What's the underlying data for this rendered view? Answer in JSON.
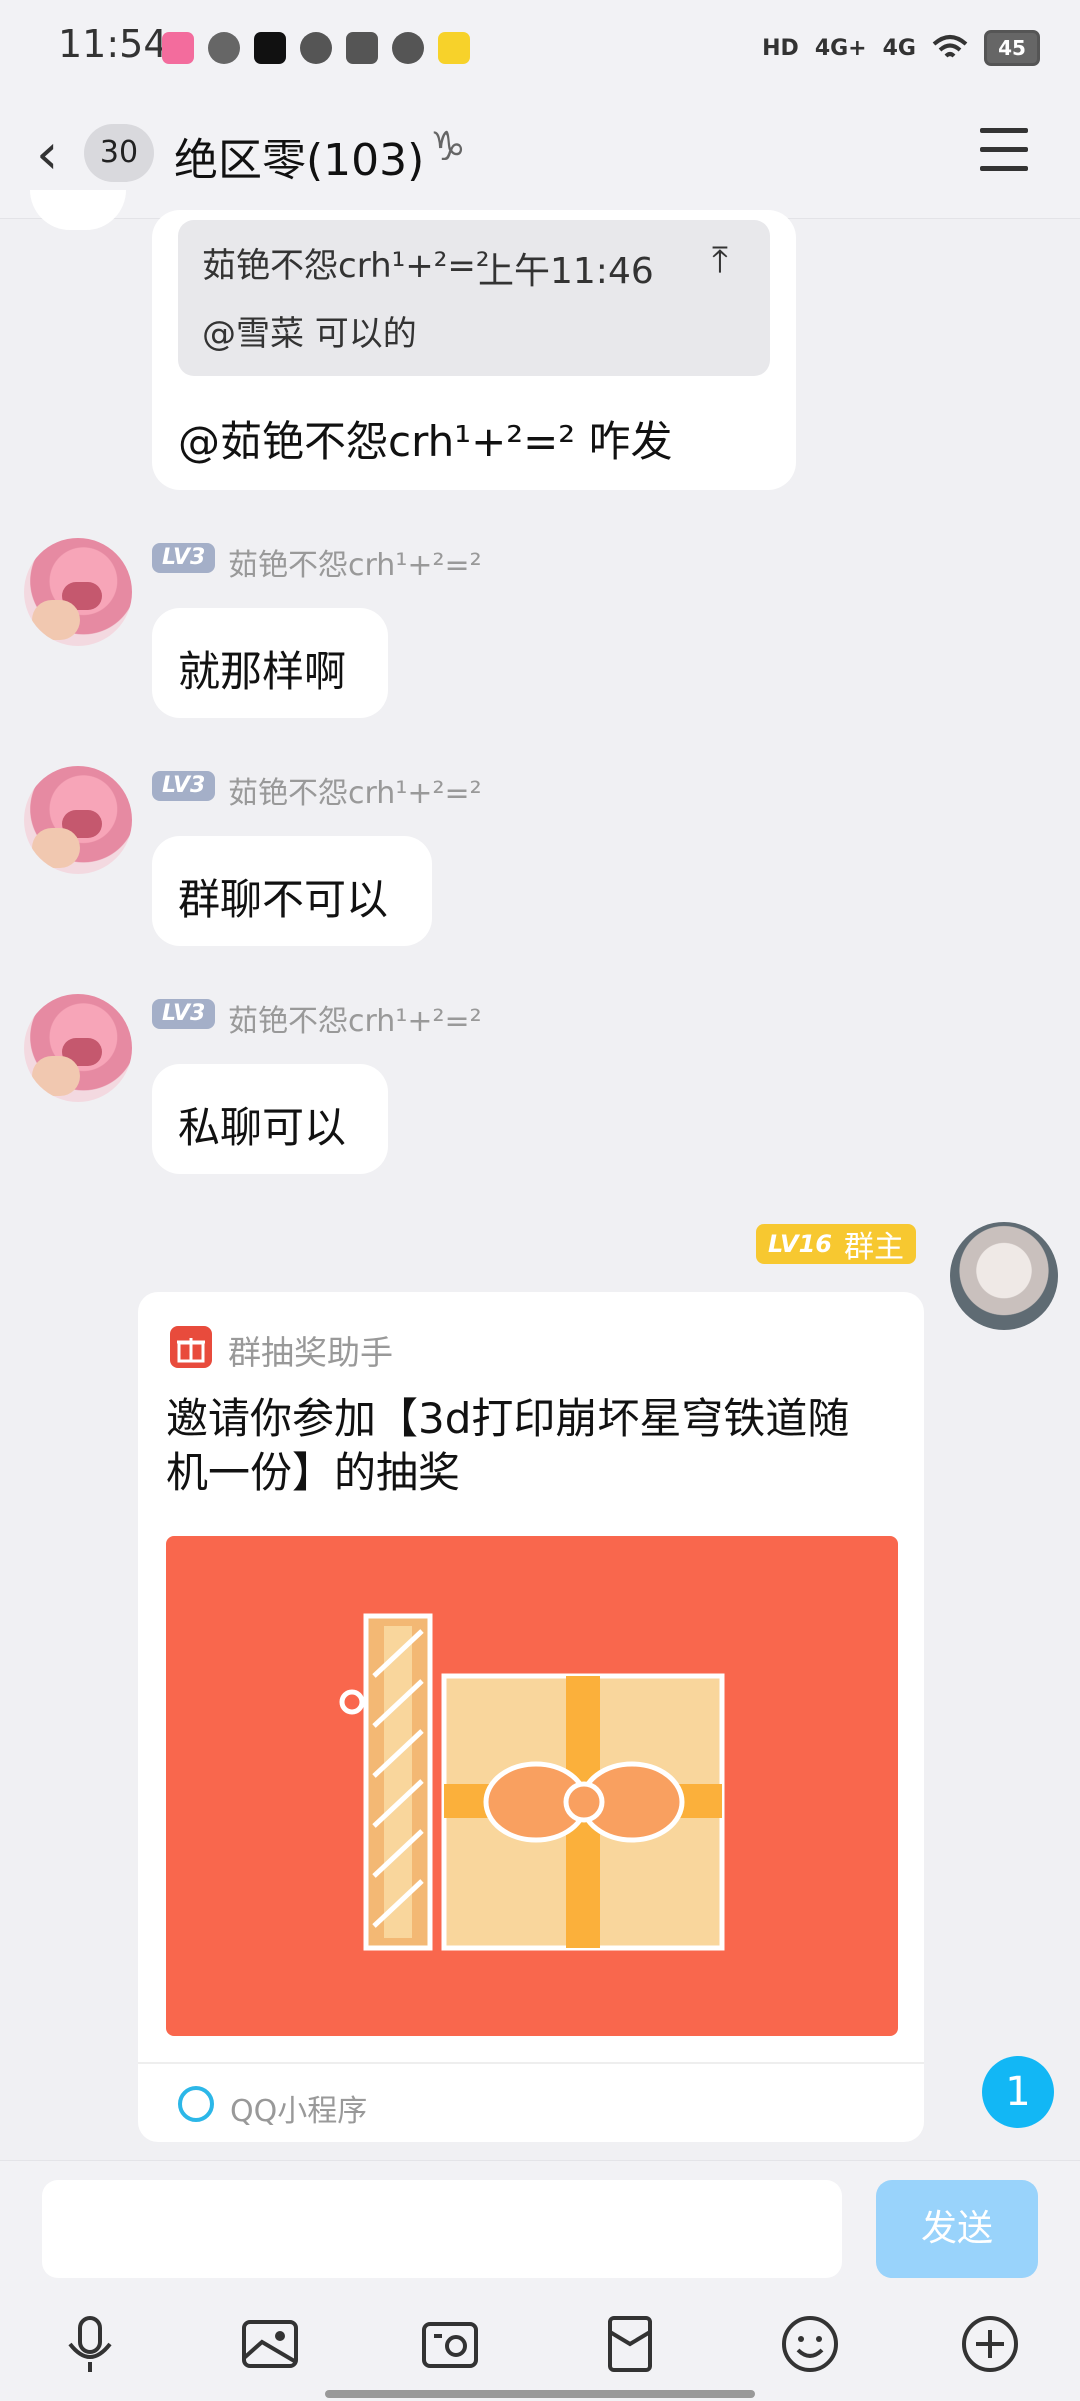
{
  "status_bar": {
    "time": "11:54",
    "battery": "45",
    "network_labels": [
      "HD",
      "4G+",
      "4G"
    ]
  },
  "header": {
    "unread_count": "30",
    "title": "绝区零(103)"
  },
  "messages": {
    "m0": {
      "quote_author": "茹铯不怨crh¹+²=²",
      "quote_time": "上午11:46",
      "quote_text": "@雪菜 可以的",
      "text": "@茹铯不怨crh¹+²=² 咋发"
    },
    "m1": {
      "level": "LV3",
      "nickname": "茹铯不怨crh¹+²=²",
      "text": "就那样啊"
    },
    "m2": {
      "level": "LV3",
      "nickname": "茹铯不怨crh¹+²=²",
      "text": "群聊不可以"
    },
    "m3": {
      "level": "LV3",
      "nickname": "茹铯不怨crh¹+²=²",
      "text": "私聊可以"
    },
    "m4": {
      "level": "LV16",
      "role": "群主",
      "card": {
        "source": "群抽奖助手",
        "title": "邀请你参加【3d打印崩坏星穹铁道随机一份】的抽奖",
        "footer": "QQ小程序"
      }
    }
  },
  "unread_indicator": "1",
  "input": {
    "send_label": "发送"
  },
  "colors": {
    "accent": "#12b7f5",
    "card_banner": "#f9674d",
    "owner_badge": "#f7c830"
  },
  "icons": [
    "microphone-icon",
    "image-icon",
    "camera-icon",
    "red-packet-icon",
    "emoji-icon",
    "plus-icon"
  ]
}
